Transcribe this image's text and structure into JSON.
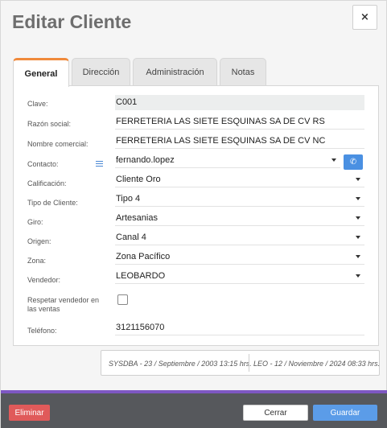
{
  "dialog": {
    "title": "Editar Cliente",
    "close_label": "×"
  },
  "tabs": [
    {
      "label": "General"
    },
    {
      "label": "Dirección"
    },
    {
      "label": "Administración"
    },
    {
      "label": "Notas"
    }
  ],
  "form": {
    "clave": {
      "label": "Clave:",
      "value": "C001"
    },
    "razon_social": {
      "label": "Razón social:",
      "value": "FERRETERIA LAS SIETE ESQUINAS SA DE CV RS"
    },
    "nombre_comercial": {
      "label": "Nombre comercial:",
      "value": "FERRETERIA LAS SIETE ESQUINAS SA DE CV NC"
    },
    "contacto": {
      "label": "Contacto:",
      "value": "fernando.lopez"
    },
    "calificacion": {
      "label": "Calificación:",
      "value": "Cliente Oro"
    },
    "tipo_cliente": {
      "label": "Tipo de Cliente:",
      "value": "Tipo 4"
    },
    "giro": {
      "label": "Giro:",
      "value": "Artesanias"
    },
    "origen": {
      "label": "Origen:",
      "value": "Canal 4"
    },
    "zona": {
      "label": "Zona:",
      "value": "Zona Pacífico"
    },
    "vendedor": {
      "label": "Vendedor:",
      "value": "LEOBARDO"
    },
    "respetar_vendedor": {
      "label_line1": "Respetar vendedor en",
      "label_line2": "las ventas",
      "checked": false
    },
    "telefono": {
      "label": "Teléfono:",
      "value": "3121156070"
    }
  },
  "audit": {
    "created": "SYSDBA - 23 / Septiembre / 2003 13:15 hrs.",
    "modified": "LEO - 12 / Noviembre / 2024 08:33 hrs."
  },
  "footer": {
    "delete_label": "Eliminar",
    "close_label": "Cerrar",
    "save_label": "Guardar"
  },
  "colors": {
    "accent_tab": "#f08a3c",
    "primary": "#5b9ce8",
    "danger": "#e05a5a",
    "footer_bg": "#56585c",
    "footer_border": "#7e57c2"
  },
  "icons": {
    "contact_list": "list-icon",
    "phone": "phone-icon",
    "dropdown": "chevron-down-icon"
  }
}
